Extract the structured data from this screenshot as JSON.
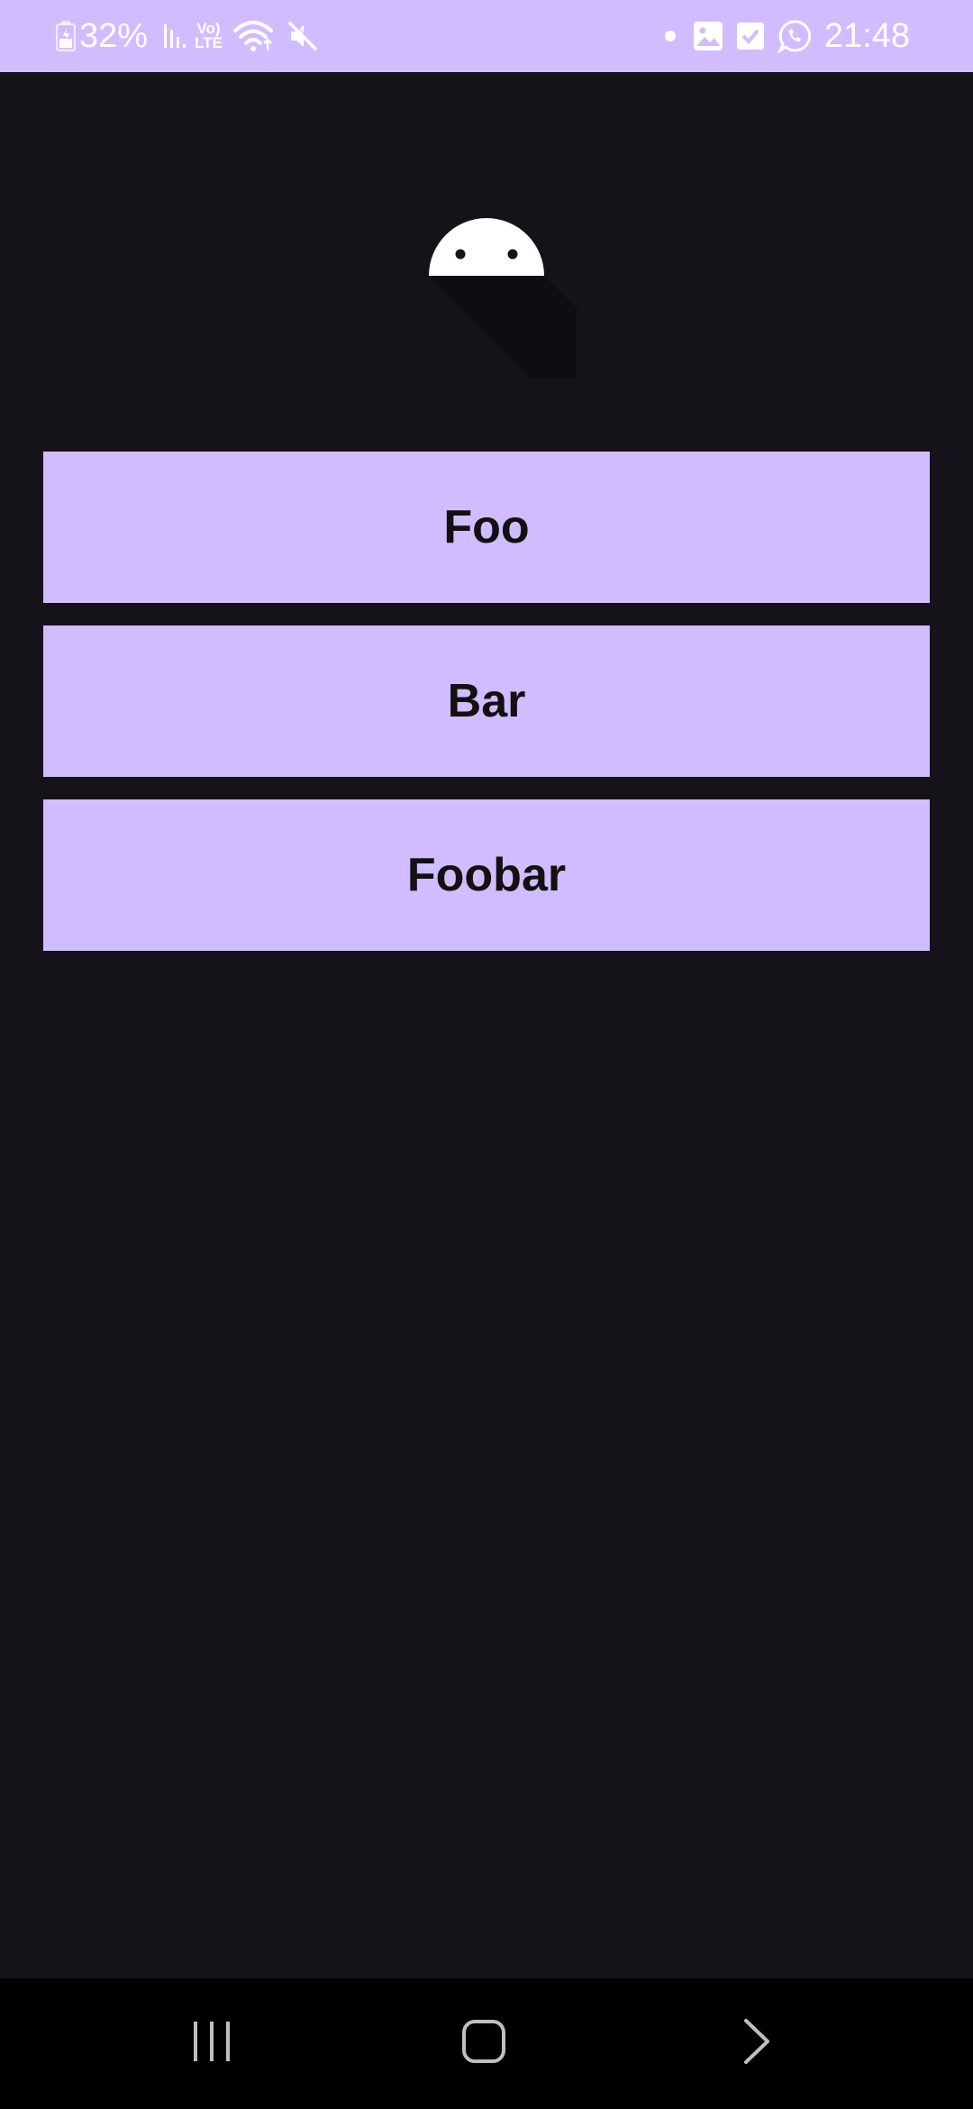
{
  "status_bar": {
    "battery_percent": "32%",
    "network_label_top": "Vo)",
    "network_label_bottom": "LTE",
    "time": "21:48",
    "icons": [
      "battery-icon",
      "signal-icon",
      "volte-icon",
      "wifi-icon",
      "mute-icon",
      "notification-dot-icon",
      "gallery-icon",
      "checkbox-icon",
      "whatsapp-icon"
    ],
    "background_color": "#d0bcfe"
  },
  "logo": {
    "icon": "android-robot-icon",
    "color": "#ffffff"
  },
  "buttons": {
    "foo_label": "Foo",
    "bar_label": "Bar",
    "foobar_label": "Foobar",
    "background_color": "#d0bcfe",
    "text_color": "#111111"
  },
  "nav_bar": {
    "icons": [
      "recents-icon",
      "home-icon",
      "back-icon"
    ]
  },
  "colors": {
    "app_background": "#151219",
    "nav_background": "#000000"
  }
}
